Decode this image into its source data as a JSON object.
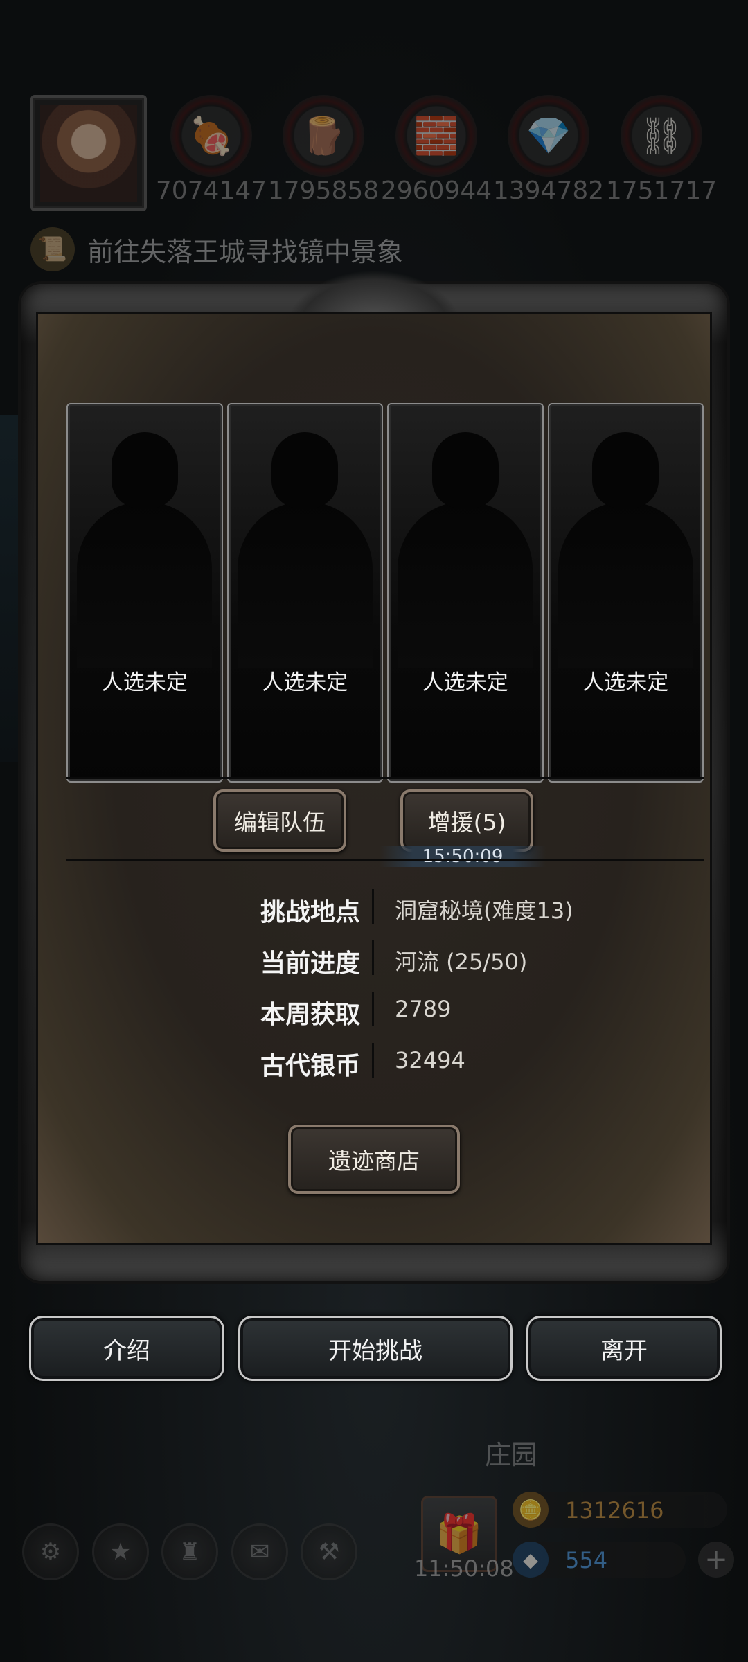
{
  "player": {
    "avatar_icon": "portrait-icon"
  },
  "resources": [
    {
      "icon": "meat-icon",
      "glyph": "🍖",
      "value": "7074147"
    },
    {
      "icon": "wood-icon",
      "glyph": "🪵",
      "value": "1795858"
    },
    {
      "icon": "stone-icon",
      "glyph": "🧱",
      "value": "2960944"
    },
    {
      "icon": "crystal-icon",
      "glyph": "💎",
      "value": "1394782"
    },
    {
      "icon": "iron-icon",
      "glyph": "⛓",
      "value": "1751717"
    }
  ],
  "quest": {
    "text": "前往失落王城寻找镜中景象",
    "icon": "scroll-icon"
  },
  "team": {
    "slots": [
      {
        "label": "人选未定"
      },
      {
        "label": "人选未定"
      },
      {
        "label": "人选未定"
      },
      {
        "label": "人选未定"
      }
    ],
    "edit_button": "编辑队伍",
    "reinforce_button": "增援(5)",
    "reinforce_timer": "15:50:09"
  },
  "info": {
    "rows": [
      {
        "key": "挑战地点",
        "value": "洞窟秘境(难度13)"
      },
      {
        "key": "当前进度",
        "value": "河流 (25/50)"
      },
      {
        "key": "本周获取",
        "value": "2789"
      },
      {
        "key": "古代银币",
        "value": "32494"
      }
    ],
    "shop_button": "遗迹商店"
  },
  "actions": {
    "intro": "介绍",
    "start": "开始挑战",
    "leave": "离开"
  },
  "bottom": {
    "manor_label": "庄园",
    "gift_timer": "11:50:08",
    "gold": "1312616",
    "gems": "554"
  },
  "colors": {
    "gold_text": "#b8863b",
    "gem_text": "#4a8fd0"
  }
}
